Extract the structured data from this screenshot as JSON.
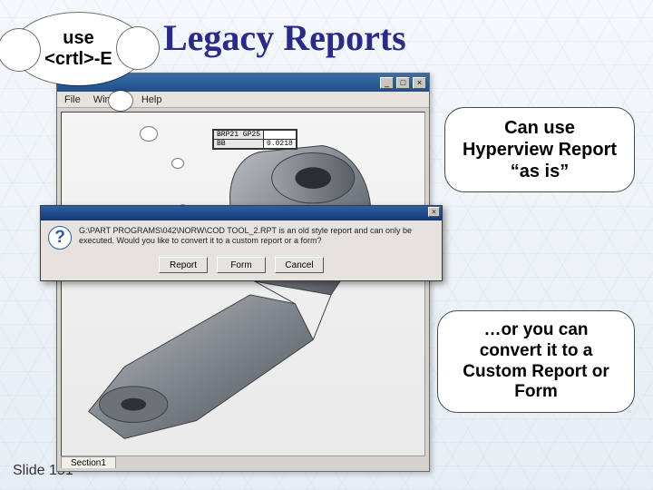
{
  "title": "Legacy Reports",
  "cloud": {
    "line1": "use",
    "line2": "<crtl>-E"
  },
  "callouts": {
    "asis": "Can use Hyperview Report “as is”",
    "convert": "…or you can convert it to a Custom Report or Form"
  },
  "menubar": {
    "file": "File",
    "window": "Window",
    "help": "Help"
  },
  "window_controls": {
    "min": "_",
    "max": "□",
    "close": "×"
  },
  "readout": {
    "r1_label": "BRP21 GP25",
    "r1_value": "",
    "r2_label": "BB",
    "r2_value": "0.0218"
  },
  "dialog": {
    "icon": "?",
    "message": "G:\\PART PROGRAMS\\042\\NORW\\COD TOOL_2.RPT is an old style report and can only be executed. Would you like to convert it to a custom report or a form?",
    "buttons": {
      "report": "Report",
      "form": "Form",
      "cancel": "Cancel"
    }
  },
  "section_tab": "Section1",
  "slide_number": "Slide 151"
}
